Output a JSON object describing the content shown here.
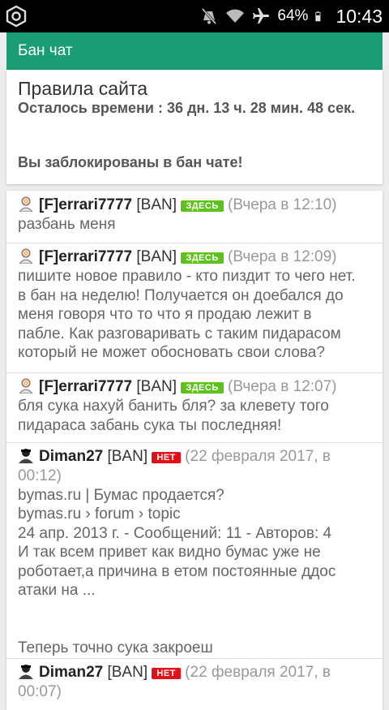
{
  "status_bar": {
    "battery": "64%",
    "time": "10:43",
    "icons": [
      "app-logo-icon",
      "mute-icon",
      "wifi-icon",
      "airplane-icon",
      "battery-icon"
    ]
  },
  "header": {
    "title": "Бан чат",
    "color": "#1a9c74"
  },
  "rules": {
    "title": "Правила сайта",
    "remaining": "Осталось времени : 36 дн. 13 ч. 28 мин. 48 сек.",
    "blocked": "Вы заблокированы в бан чате!"
  },
  "messages": [
    {
      "user": "[F]errari7777",
      "ban": "[BAN]",
      "badge": "ЗДЕСЬ",
      "badge_color": "#5dc31a",
      "time": "(Вчера в 12:10)",
      "text_lines": [
        "разбань меня"
      ]
    },
    {
      "user": "[F]errari7777",
      "ban": "[BAN]",
      "badge": "ЗДЕСЬ",
      "badge_color": "#5dc31a",
      "time": "(Вчера в 12:09)",
      "text_lines": [
        "пишите новое правило - кто пиздит то чего нет.",
        "в бан на неделю! Получается он доебался до",
        "меня говоря что то что я продаю лежит в",
        "пабле. Как разговаривать с таким пидарасом",
        "который не может обосновать свои слова?"
      ]
    },
    {
      "user": "[F]errari7777",
      "ban": "[BAN]",
      "badge": "ЗДЕСЬ",
      "badge_color": "#5dc31a",
      "time": "(Вчера в 12:07)",
      "text_lines": [
        "бля сука нахуй банить бля? за клевету того",
        "пидараса забань сука ты последняя!"
      ]
    },
    {
      "user": "Diman27",
      "ban": "[BAN]",
      "badge": "НЕТ",
      "badge_color": "#e3101a",
      "time": "(22 февраля 2017, в",
      "text_lines": [
        "00:12)",
        "bymas.ru | Бумас продается?",
        "bymas.ru › forum › topic",
        "24 апр. 2013 г. - Сообщений: 11 - Авторов: 4",
        "И так всем привет как видно бумас уже не",
        "роботает,а причина в етом постоянные ддос",
        "атаки на ...",
        "",
        "",
        "Теперь точно сука закроеш"
      ]
    },
    {
      "user": "Diman27",
      "ban": "[BAN]",
      "badge": "НЕТ",
      "badge_color": "#e3101a",
      "time": "(22 февраля 2017, в",
      "text_lines": [
        "00:07)"
      ]
    }
  ]
}
